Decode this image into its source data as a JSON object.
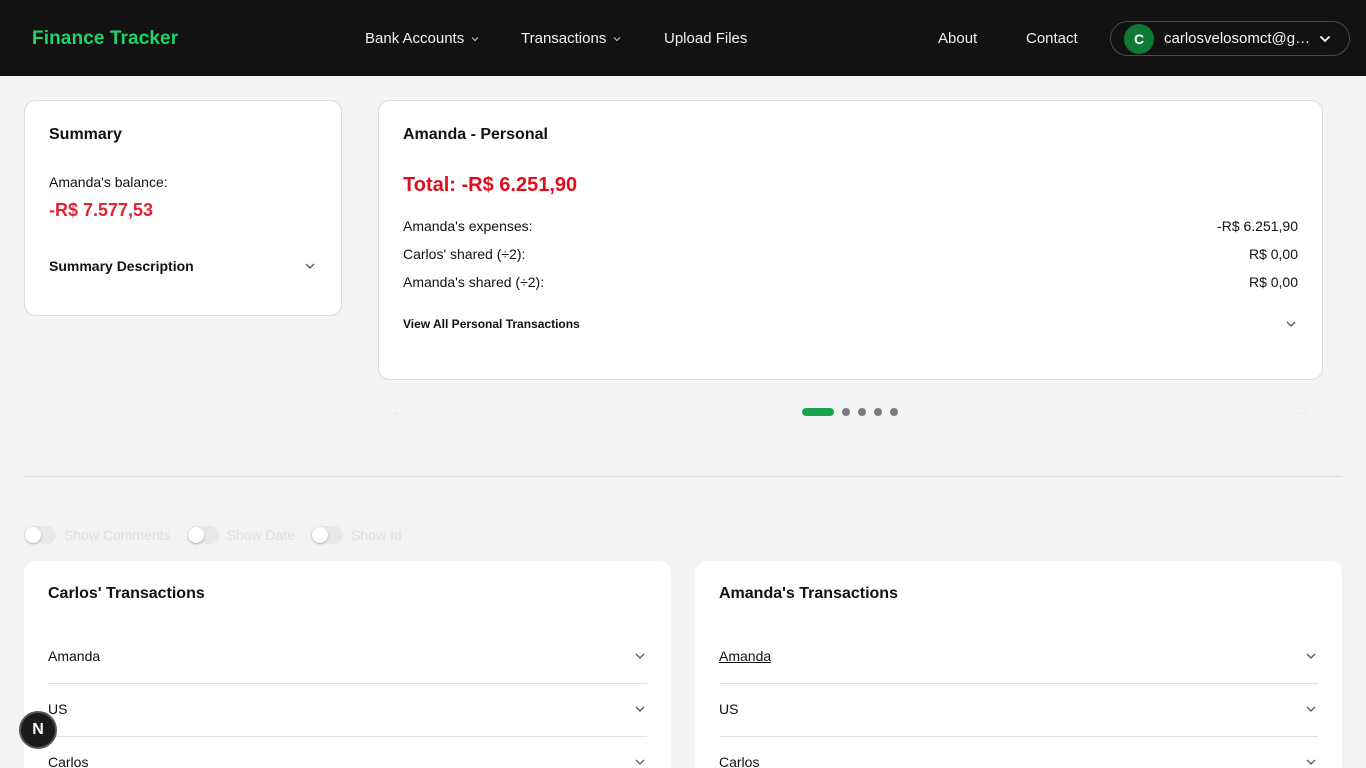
{
  "navbar": {
    "brand": "Finance Tracker",
    "items": [
      {
        "label": "Bank Accounts"
      },
      {
        "label": "Transactions"
      },
      {
        "label": "Upload Files"
      },
      {
        "label": "About"
      },
      {
        "label": "Contact"
      }
    ],
    "user": {
      "initial": "C",
      "email": "carlosvelosomct@gmail.com"
    }
  },
  "summary": {
    "title": "Summary",
    "balance_label": "Amanda's balance:",
    "balance_value": "-R$ 7.577,53",
    "description_label": "Summary Description"
  },
  "personal": {
    "title": "Amanda - Personal",
    "total": "Total: -R$ 6.251,90",
    "rows": [
      {
        "label": "Amanda's expenses:",
        "value": "-R$ 6.251,90"
      },
      {
        "label": "Carlos' shared (÷2):",
        "value": "R$ 0,00"
      },
      {
        "label": "Amanda's shared (÷2):",
        "value": "R$ 0,00"
      }
    ],
    "view_all": "View All Personal Transactions"
  },
  "carousel": {
    "prev": "←",
    "next": "→",
    "slides": 5,
    "active_index": 0
  },
  "toggles": [
    {
      "label": "Show Comments",
      "on": false
    },
    {
      "label": "Show Date",
      "on": false
    },
    {
      "label": "Show Id",
      "on": false
    }
  ],
  "carlos_tx": {
    "title": "Carlos' Transactions",
    "groups": [
      "Amanda",
      "US",
      "Carlos"
    ]
  },
  "amanda_tx": {
    "title": "Amanda's Transactions",
    "groups": [
      "Amanda",
      "US",
      "Carlos"
    ]
  },
  "badge": {
    "letter": "N"
  },
  "colors": {
    "brand": "#1fd468",
    "negative": "#e00d1f",
    "accent": "#18a44a",
    "navbar": "#121212"
  }
}
